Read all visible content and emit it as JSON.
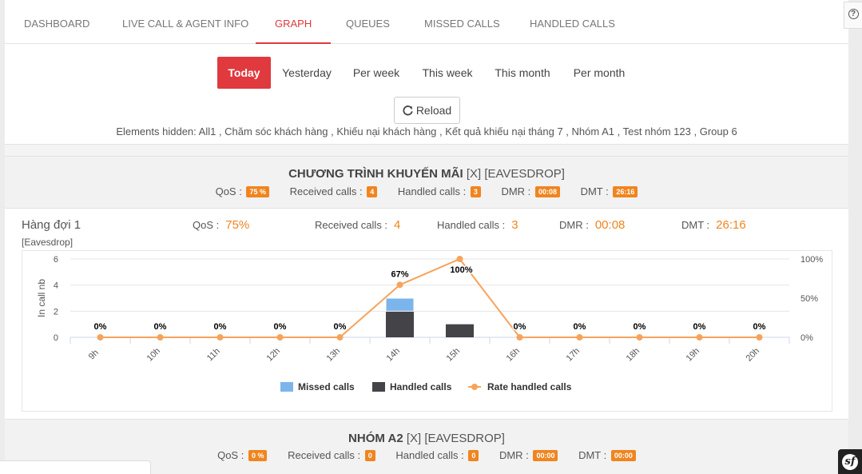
{
  "tabs": [
    {
      "label": "DASHBOARD"
    },
    {
      "label": "LIVE CALL & AGENT INFO"
    },
    {
      "label": "GRAPH"
    },
    {
      "label": "QUEUES"
    },
    {
      "label": "MISSED CALLS"
    },
    {
      "label": "HANDLED CALLS"
    }
  ],
  "active_tab": "GRAPH",
  "help_label": "?",
  "periods": [
    {
      "label": "Today"
    },
    {
      "label": "Yesterday"
    },
    {
      "label": "Per week"
    },
    {
      "label": "This week"
    },
    {
      "label": "This month"
    },
    {
      "label": "Per month"
    }
  ],
  "active_period": "Today",
  "reload": {
    "icon": "refresh-icon",
    "label": "Reload"
  },
  "hidden_elements_text": "Elements hidden: All1 , Chăm sóc khách hàng , Khiếu nại khách hàng , Kết quả khiếu nại tháng 7 , Nhóm A1 , Test nhóm 123 , Group 6",
  "section1": {
    "title": "CHƯƠNG TRÌNH KHUYẾN MÃI",
    "suffix": " [X] [EAVESDROP]",
    "qos_label": "QoS :",
    "qos": "75 %",
    "received_label": "Received calls :",
    "received": "4",
    "handled_label": "Handled calls :",
    "handled": "3",
    "dmr_label": "DMR :",
    "dmr": "00:08",
    "dmt_label": "DMT :",
    "dmt": "26:16"
  },
  "queue": {
    "name": "Hàng đợi 1",
    "sub": "[Eavesdrop]",
    "qos_label": "QoS :",
    "qos": "75%",
    "received_label": "Received calls :",
    "received": "4",
    "handled_label": "Handled calls :",
    "handled": "3",
    "dmr_label": "DMR :",
    "dmr": "00:08",
    "dmt_label": "DMT :",
    "dmt": "26:16"
  },
  "section2": {
    "title": "NHÓM A2",
    "suffix": " [X] [EAVESDROP]",
    "qos_label": "QoS :",
    "qos": "0 %",
    "received_label": "Received calls :",
    "received": "0",
    "handled_label": "Handled calls :",
    "handled": "0",
    "dmr_label": "DMR :",
    "dmr": "00:00",
    "dmt_label": "DMT :",
    "dmt": "00:00"
  },
  "colors": {
    "accent": "#e0393e",
    "badge": "#f0851f",
    "missed": "#7cb5ec",
    "handled": "#434348",
    "rate": "#f7a35c"
  },
  "chart_data": {
    "type": "bar",
    "categories": [
      "9h",
      "10h",
      "11h",
      "12h",
      "13h",
      "14h",
      "15h",
      "16h",
      "17h",
      "18h",
      "19h",
      "20h"
    ],
    "series": [
      {
        "name": "Missed calls",
        "kind": "stacked-bar",
        "values": [
          0,
          0,
          0,
          0,
          0,
          1,
          0,
          0,
          0,
          0,
          0,
          0
        ]
      },
      {
        "name": "Handled calls",
        "kind": "stacked-bar",
        "values": [
          0,
          0,
          0,
          0,
          0,
          2,
          1,
          0,
          0,
          0,
          0,
          0
        ]
      },
      {
        "name": "Rate handled calls",
        "kind": "line",
        "axis": "right",
        "values": [
          0,
          0,
          0,
          0,
          0,
          67,
          100,
          0,
          0,
          0,
          0,
          0
        ]
      }
    ],
    "data_labels": [
      "0%",
      "0%",
      "0%",
      "0%",
      "0%",
      "67%",
      "100%",
      "0%",
      "0%",
      "0%",
      "0%",
      "0%"
    ],
    "ylabel": "In call nb",
    "ylim": [
      0,
      6
    ],
    "yticks": [
      "0",
      "2",
      "4",
      "6"
    ],
    "y2lim": [
      0,
      100
    ],
    "y2ticks": [
      "0%",
      "50%",
      "100%"
    ],
    "legend_position": "bottom-center",
    "grid": true
  }
}
